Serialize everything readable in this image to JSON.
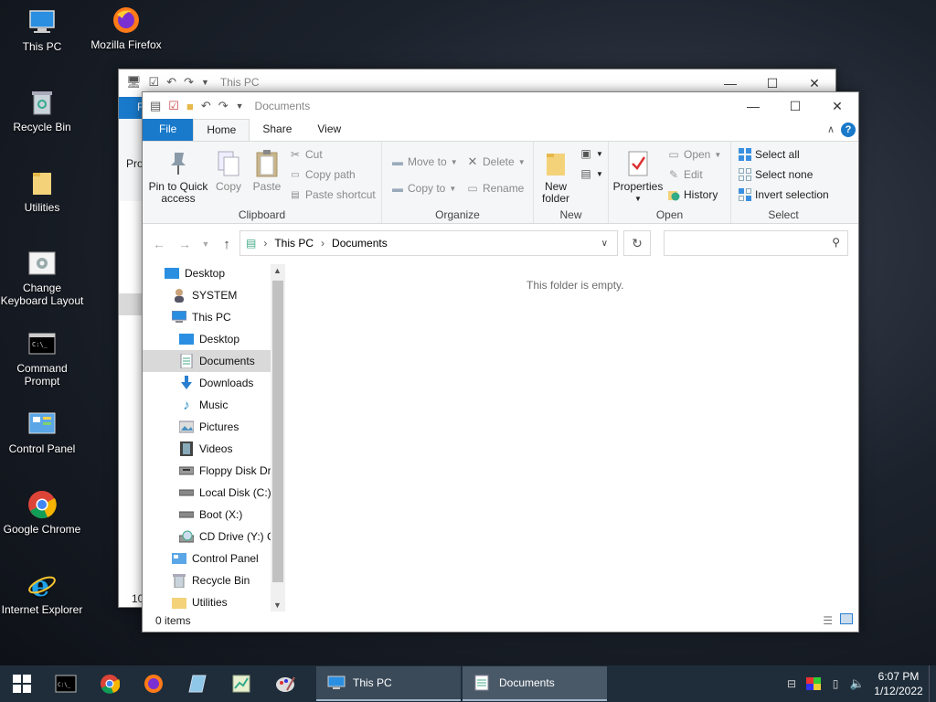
{
  "desktop": {
    "icons": [
      {
        "label": "This PC"
      },
      {
        "label": "Mozilla Firefox"
      },
      {
        "label": "Recycle Bin"
      },
      {
        "label": "Utilities"
      },
      {
        "label": "Change Keyboard Layout"
      },
      {
        "label": "Command Prompt"
      },
      {
        "label": "Control Panel"
      },
      {
        "label": "Google Chrome"
      },
      {
        "label": "Internet Explorer"
      }
    ]
  },
  "back_window": {
    "title": "This PC",
    "file_tab": "Fi",
    "partial_text": "Pro",
    "partial_status": "10"
  },
  "explorer": {
    "title": "Documents",
    "tabs": {
      "file": "File",
      "home": "Home",
      "share": "Share",
      "view": "View"
    },
    "ribbon": {
      "clipboard": {
        "label": "Clipboard",
        "pin": "Pin to Quick access",
        "copy": "Copy",
        "paste": "Paste",
        "cut": "Cut",
        "copy_path": "Copy path",
        "paste_shortcut": "Paste shortcut"
      },
      "organize": {
        "label": "Organize",
        "move_to": "Move to",
        "copy_to": "Copy to",
        "delete": "Delete",
        "rename": "Rename"
      },
      "new": {
        "label": "New",
        "new_folder": "New folder"
      },
      "open": {
        "label": "Open",
        "properties": "Properties",
        "open": "Open",
        "edit": "Edit",
        "history": "History"
      },
      "select": {
        "label": "Select",
        "select_all": "Select all",
        "select_none": "Select none",
        "invert": "Invert selection"
      }
    },
    "address": {
      "crumb1": "This PC",
      "crumb2": "Documents"
    },
    "search": {
      "placeholder": ""
    },
    "nav_items": [
      {
        "label": "Desktop"
      },
      {
        "label": "SYSTEM"
      },
      {
        "label": "This PC"
      },
      {
        "label": "Desktop"
      },
      {
        "label": "Documents"
      },
      {
        "label": "Downloads"
      },
      {
        "label": "Music"
      },
      {
        "label": "Pictures"
      },
      {
        "label": "Videos"
      },
      {
        "label": "Floppy Disk Dri"
      },
      {
        "label": "Local Disk (C:)"
      },
      {
        "label": "Boot (X:)"
      },
      {
        "label": "CD Drive (Y:) C"
      },
      {
        "label": "Control Panel"
      },
      {
        "label": "Recycle Bin"
      },
      {
        "label": "Utilities"
      }
    ],
    "empty_message": "This folder is empty.",
    "status": "0 items"
  },
  "taskbar": {
    "tasks": [
      {
        "label": "This PC"
      },
      {
        "label": "Documents"
      }
    ],
    "clock": {
      "time": "6:07 PM",
      "date": "1/12/2022"
    }
  },
  "colors": {
    "accent": "#1979ca",
    "taskbar": "#1f2d3a"
  }
}
